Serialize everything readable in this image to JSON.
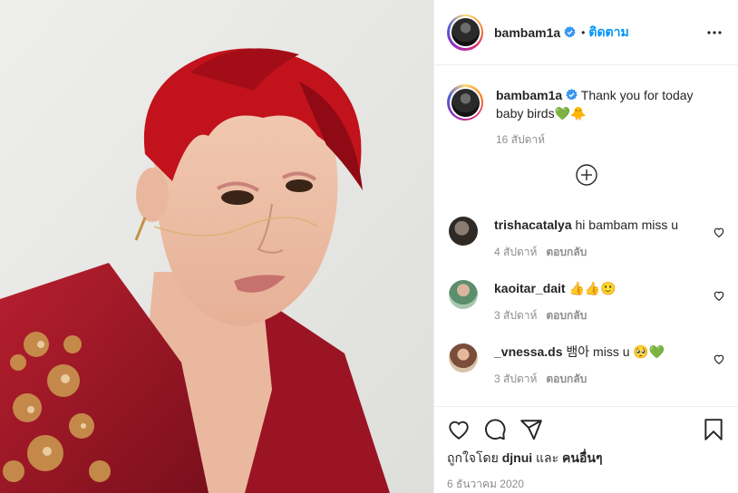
{
  "post": {
    "author": "bambam1a",
    "follow_label": "ติดตาม",
    "dot": "•"
  },
  "caption": {
    "username": "bambam1a",
    "text": "Thank you for today baby birds💚🐥",
    "time": "16 สัปดาห์"
  },
  "comments": [
    {
      "username": "trishacatalya",
      "text": "hi bambam miss u",
      "time": "4 สัปดาห์",
      "reply": "ตอบกลับ"
    },
    {
      "username": "kaoitar_dait",
      "text": "👍👍🙂",
      "time": "3 สัปดาห์",
      "reply": "ตอบกลับ"
    },
    {
      "username": "_vnessa.ds",
      "text": "뱀아 miss u 🥺💚",
      "time": "3 สัปดาห์",
      "reply": "ตอบกลับ"
    }
  ],
  "likes": {
    "prefix": "ถูกใจโดย",
    "user": "djnui",
    "and": "และ",
    "others": "คนอื่นๆ"
  },
  "date": "6 ธันวาคม 2020",
  "colors": {
    "accent": "#0095f6",
    "verified": "#3897f0",
    "hair": "#c2121c",
    "jacket": "#a01828"
  },
  "icons": [
    "more-icon",
    "verified-icon",
    "add-circle-icon",
    "heart-icon",
    "comment-icon",
    "share-icon",
    "bookmark-icon"
  ]
}
